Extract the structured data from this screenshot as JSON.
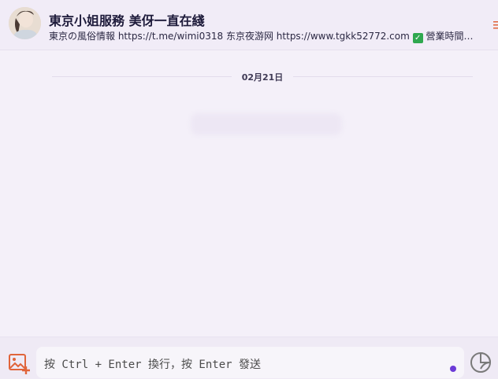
{
  "header": {
    "title": "東京小姐服務 美伢一直在綫",
    "subtitle_prefix": "東京の風俗情報 https://t.me/wimi0318 东京夜游网 https://www.tgkk52772.com",
    "subtitle_suffix": " 營業時間：..."
  },
  "conversation": {
    "date_separator": "02月21日"
  },
  "composer": {
    "placeholder": "按 Ctrl + Enter 換行，按 Enter 發送"
  },
  "icons": {
    "avatar": "avatar-photo",
    "attach": "image-add-icon",
    "sticker": "sticker-icon",
    "menu": "menu-icon",
    "check": "check-mark-icon"
  },
  "colors": {
    "accent": "#6c3bd7",
    "attach_icon": "#e0643a",
    "check_bg": "#2fa84f"
  }
}
